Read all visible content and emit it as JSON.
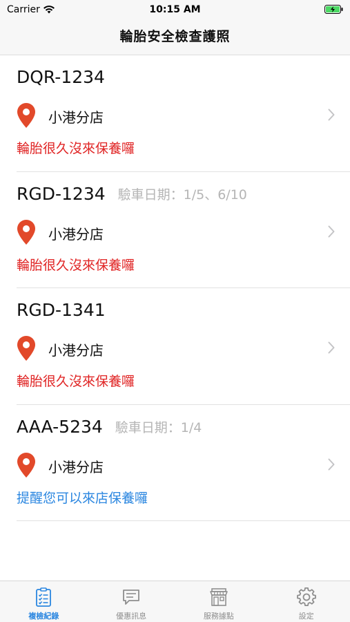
{
  "status_bar": {
    "carrier": "Carrier",
    "time": "10:15 AM"
  },
  "nav": {
    "title": "輪胎安全檢查護照"
  },
  "vehicles": [
    {
      "plate": "DQR-1234",
      "inspection": "",
      "store": "小港分店",
      "reminder": "輪胎很久沒來保養囉",
      "reminder_color": "red"
    },
    {
      "plate": "RGD-1234",
      "inspection": "驗車日期：1/5、6/10",
      "store": "小港分店",
      "reminder": "輪胎很久沒來保養囉",
      "reminder_color": "red"
    },
    {
      "plate": "RGD-1341",
      "inspection": "",
      "store": "小港分店",
      "reminder": "輪胎很久沒來保養囉",
      "reminder_color": "red"
    },
    {
      "plate": "AAA-5234",
      "inspection": "驗車日期：1/4",
      "store": "小港分店",
      "reminder": "提醒您可以來店保養囉",
      "reminder_color": "blue"
    }
  ],
  "tabs": [
    {
      "label": "複檢紀錄",
      "icon": "checklist-icon",
      "active": true
    },
    {
      "label": "優惠訊息",
      "icon": "message-icon",
      "active": false
    },
    {
      "label": "服務據點",
      "icon": "store-icon",
      "active": false
    },
    {
      "label": "設定",
      "icon": "gear-icon",
      "active": false
    }
  ],
  "colors": {
    "accent": "#2a86e0",
    "warning": "#e02424",
    "pin": "#e2492a",
    "muted": "#b5b5b5"
  }
}
